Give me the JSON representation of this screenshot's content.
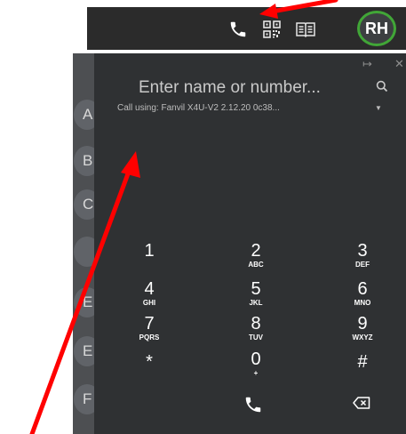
{
  "header": {
    "icons": [
      "phone-icon",
      "qr-code-icon",
      "address-book-icon"
    ],
    "avatar_initials": "RH",
    "avatar_ring_color": "#41a637"
  },
  "contact_letters": [
    "A",
    "B",
    "C",
    "",
    "E",
    "E",
    "F"
  ],
  "dialer": {
    "search_placeholder": "Enter name or number...",
    "call_using": "Call using: Fanvil X4U-V2 2.12.20 0c38...",
    "keys": [
      {
        "digit": "1",
        "letters": ""
      },
      {
        "digit": "2",
        "letters": "ABC"
      },
      {
        "digit": "3",
        "letters": "DEF"
      },
      {
        "digit": "4",
        "letters": "GHI"
      },
      {
        "digit": "5",
        "letters": "JKL"
      },
      {
        "digit": "6",
        "letters": "MNO"
      },
      {
        "digit": "7",
        "letters": "PQRS"
      },
      {
        "digit": "8",
        "letters": "TUV"
      },
      {
        "digit": "9",
        "letters": "WXYZ"
      },
      {
        "digit": "*",
        "letters": ""
      },
      {
        "digit": "0",
        "letters": "+"
      },
      {
        "digit": "#",
        "letters": ""
      }
    ]
  },
  "annotation_color": "#ff0000"
}
